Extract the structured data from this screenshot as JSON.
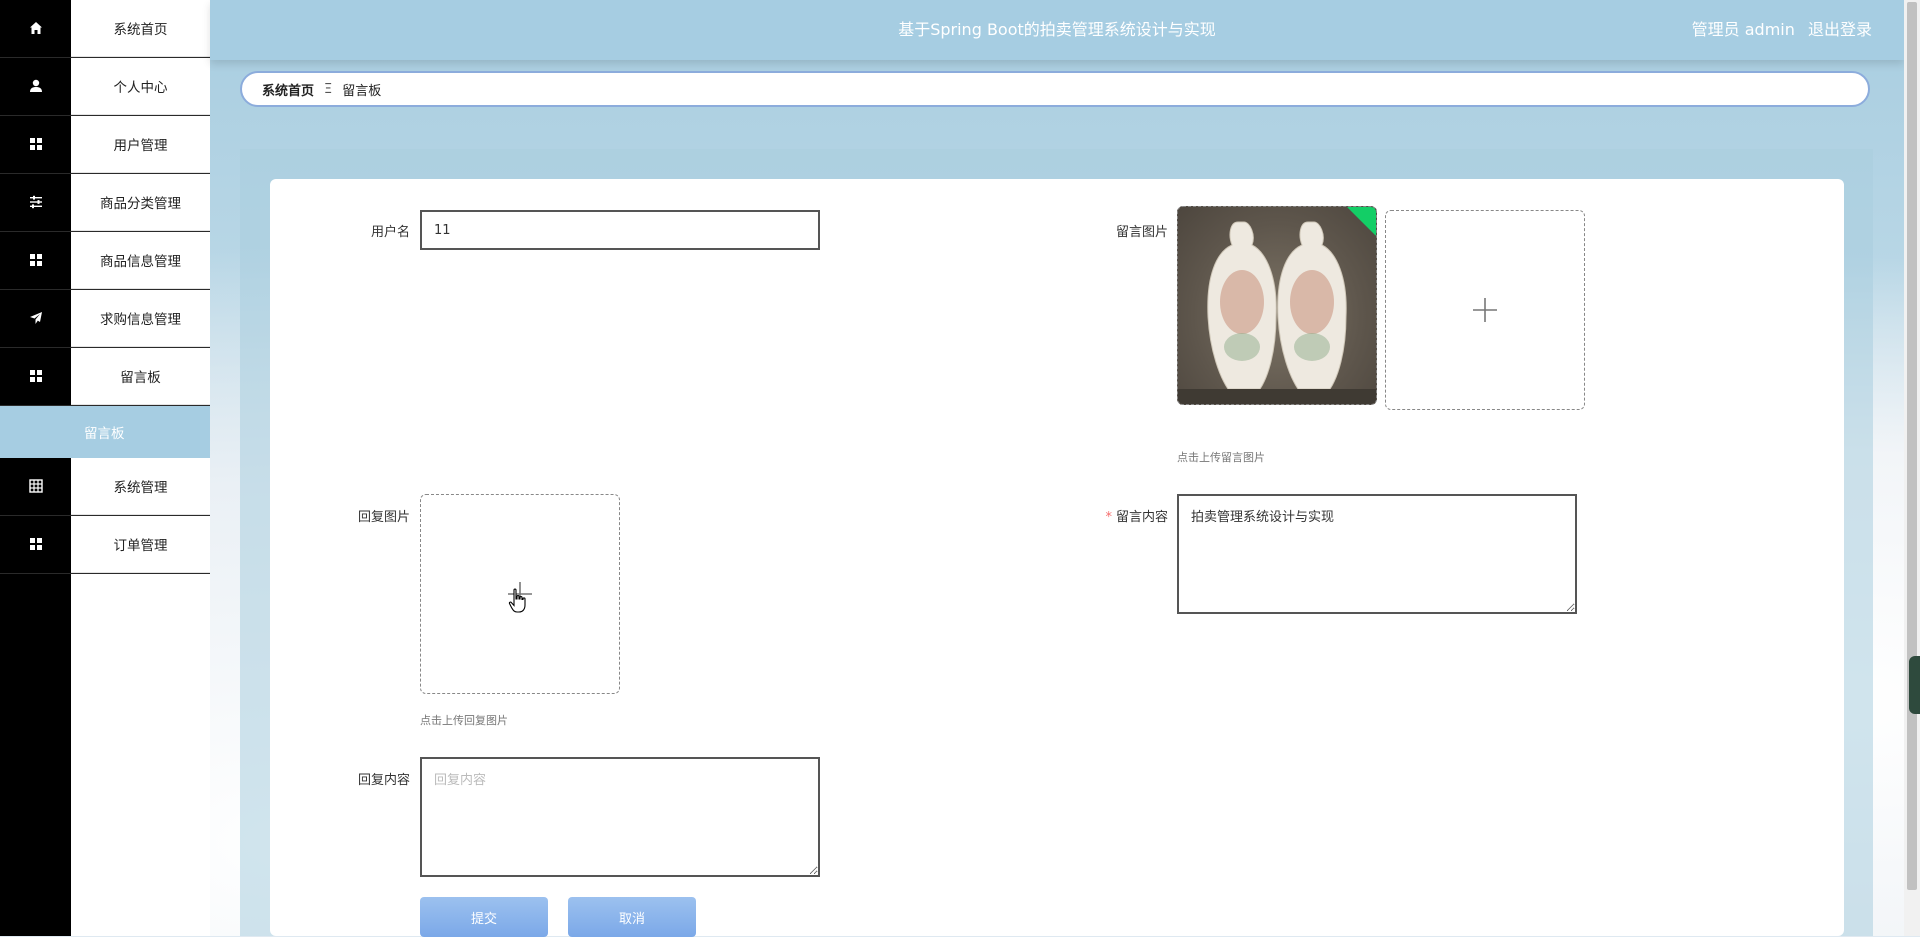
{
  "header": {
    "title": "基于Spring Boot的拍卖管理系统设计与实现",
    "user_label": "管理员 admin",
    "logout_label": "退出登录"
  },
  "sidebar": {
    "items": [
      {
        "label": "系统首页",
        "icon": "home-icon"
      },
      {
        "label": "个人中心",
        "icon": "user-icon"
      },
      {
        "label": "用户管理",
        "icon": "grid-icon"
      },
      {
        "label": "商品分类管理",
        "icon": "sliders-icon"
      },
      {
        "label": "商品信息管理",
        "icon": "grid-icon"
      },
      {
        "label": "求购信息管理",
        "icon": "send-icon"
      },
      {
        "label": "留言板",
        "icon": "grid-icon"
      }
    ],
    "active_sub": "留言板",
    "items_after": [
      {
        "label": "系统管理",
        "icon": "table-icon"
      },
      {
        "label": "订单管理",
        "icon": "grid-icon"
      }
    ]
  },
  "breadcrumb": {
    "home": "系统首页",
    "separator": "Ξ",
    "current": "留言板"
  },
  "form": {
    "username": {
      "label": "用户名",
      "value": "11"
    },
    "message_image": {
      "label": "留言图片",
      "hint": "点击上传留言图片"
    },
    "reply_image": {
      "label": "回复图片",
      "hint": "点击上传回复图片"
    },
    "message_content": {
      "label": "留言内容",
      "value": "拍卖管理系统设计与实现"
    },
    "reply_content": {
      "label": "回复内容",
      "placeholder": "回复内容",
      "value": ""
    },
    "submit_label": "提交",
    "cancel_label": "取消"
  },
  "colors": {
    "header_bg": "#a6cde2",
    "sidebar_icon_bg": "#000000",
    "button_bg": "#7ba8e8",
    "breadcrumb_border": "#8cacdc",
    "upload_success": "#13ce66"
  }
}
